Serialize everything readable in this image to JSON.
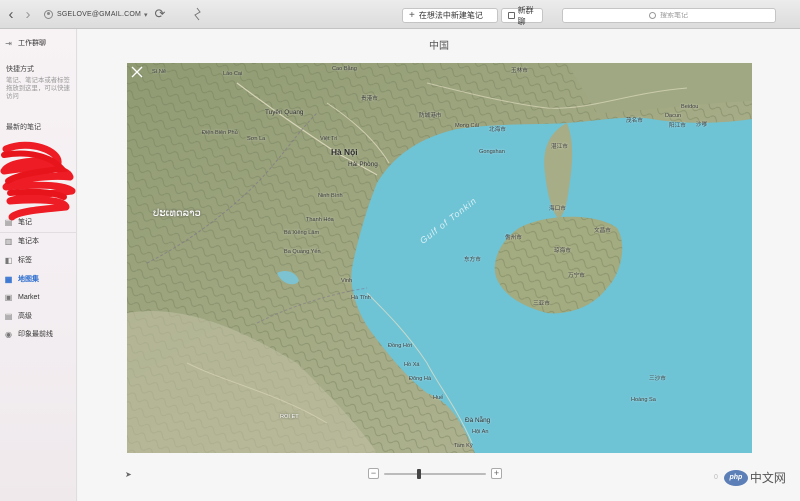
{
  "toolbar": {
    "account": "SGELOVE@GMAIL.COM",
    "new_note": "在想法中新建笔记",
    "new_chat": "新群聊",
    "search_placeholder": "搜索笔记"
  },
  "sidebar": {
    "work_chat": "工作群聊",
    "shortcuts_title": "快捷方式",
    "shortcuts_hint": "笔记、笔记本或者标签拖放到这里，可以快速访问",
    "recent_title": "最新的笔记",
    "items": [
      {
        "label": "笔记",
        "icon": "note-icon"
      },
      {
        "label": "笔记本",
        "icon": "notebook-icon"
      },
      {
        "label": "标签",
        "icon": "tag-icon"
      },
      {
        "label": "地图集",
        "icon": "atlas-icon",
        "active": true
      },
      {
        "label": "Market",
        "icon": "market-icon"
      },
      {
        "label": "高级",
        "icon": "premium-icon"
      },
      {
        "label": "印象最前线",
        "icon": "frontline-icon"
      }
    ]
  },
  "main": {
    "title": "中国"
  },
  "map": {
    "labels": [
      "Sì Nê",
      "Lào Cai",
      "Cao Bằng",
      "Tuyên Quang",
      "Điện Biên Phủ",
      "Sơn La",
      "Việt Trì",
      "Hà Nội",
      "Hải Phòng",
      "Ninh Bình",
      "Thanh Hóa",
      "Bà Xiêng Lâm",
      "Ba Quang Yến",
      "Vinh",
      "Hà Tĩnh",
      "Đồng Hới",
      "Hồ Xá",
      "Đông Hà",
      "Huế",
      "Đà Nẵng",
      "Hội An",
      "Tam Kỳ",
      "Mong Cái",
      "Gongshan",
      "北海市",
      "湛江市",
      "茂名市",
      "阳江市",
      "Beidou",
      "Dacun",
      "沙嗲",
      "防城港市",
      "海口市",
      "儋州市",
      "文昌市",
      "东方市",
      "琼海市",
      "万宁市",
      "三亚市",
      "三沙市",
      "Hoàng Sa",
      "玉林市",
      "贵港市",
      "ROI ET",
      "Gulf of Tonkin",
      "ປະເທດລາວ"
    ]
  },
  "footer": {
    "brand": "中文网",
    "brand_badge": "php"
  }
}
